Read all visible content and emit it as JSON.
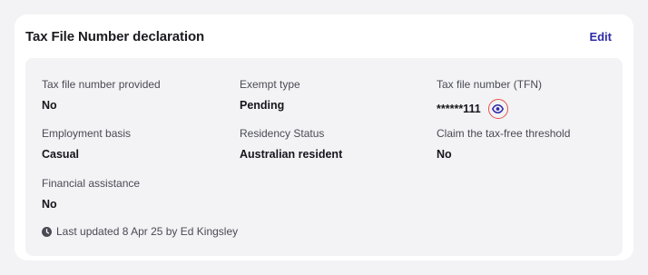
{
  "card": {
    "title": "Tax File Number declaration",
    "edit_label": "Edit"
  },
  "fields": {
    "tfn_provided": {
      "label": "Tax file number provided",
      "value": "No"
    },
    "exempt_type": {
      "label": "Exempt type",
      "value": "Pending"
    },
    "tfn": {
      "label": "Tax file number (TFN)",
      "value": "******111"
    },
    "employment_basis": {
      "label": "Employment basis",
      "value": "Casual"
    },
    "residency_status": {
      "label": "Residency Status",
      "value": "Australian resident"
    },
    "tax_free_threshold": {
      "label": "Claim the tax-free threshold",
      "value": "No"
    },
    "financial_assistance": {
      "label": "Financial assistance",
      "value": "No"
    }
  },
  "footer": {
    "last_updated": "Last updated 8 Apr 25 by Ed Kingsley"
  },
  "icons": {
    "reveal": "eye-icon",
    "updated": "clock-icon"
  },
  "colors": {
    "accent": "#2d2aa8",
    "highlight_ring": "#e8504a",
    "panel_bg": "#f3f3f5"
  }
}
